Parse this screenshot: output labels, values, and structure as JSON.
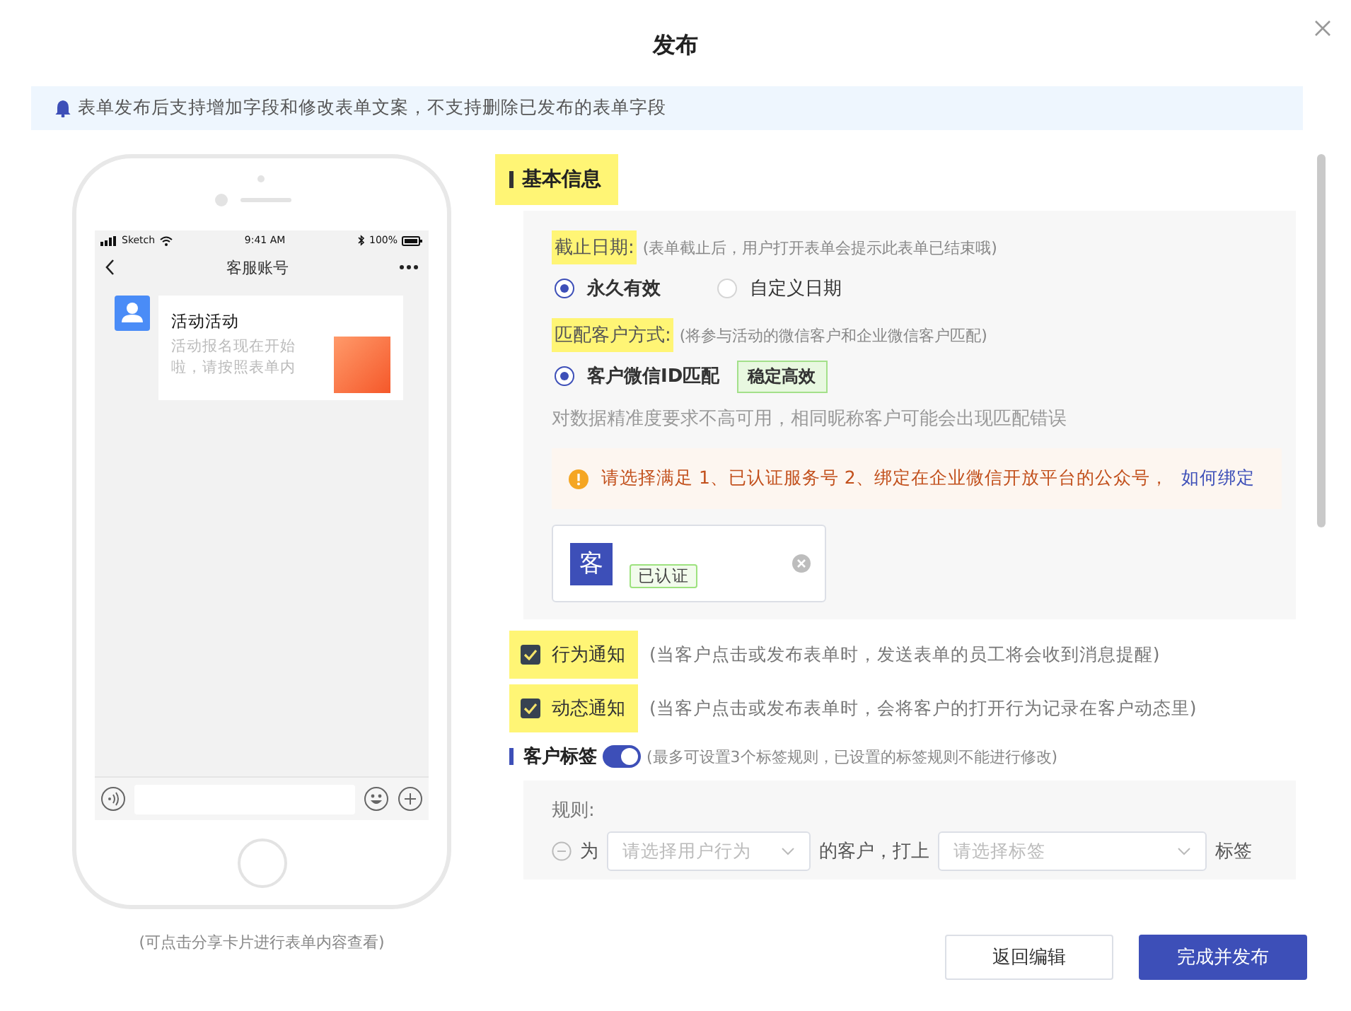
{
  "dialog": {
    "title": "发布"
  },
  "notice": {
    "text": "表单发布后支持增加字段和修改表单文案，不支持删除已发布的表单字段"
  },
  "phone": {
    "status": {
      "carrier": "Sketch",
      "time": "9:41 AM",
      "battery": "100%"
    },
    "nav_title": "客服账号",
    "message": {
      "title": "活动活动",
      "desc": "活动报名现在开始啦，请按照表单内"
    },
    "caption": "(可点击分享卡片进行表单内容查看)"
  },
  "form": {
    "section": {
      "title": "基本信息",
      "highlighted": true
    },
    "deadline": {
      "label": "截止日期:",
      "highlighted": true,
      "hint": "(表单截止后，用户打开表单会提示此表单已结束哦)",
      "options": [
        {
          "label": "永久有效",
          "selected": true
        },
        {
          "label": "自定义日期",
          "selected": false
        }
      ]
    },
    "match": {
      "label": "匹配客户方式:",
      "highlighted": true,
      "hint": "(将参与活动的微信客户和企业微信客户匹配)",
      "options": [
        {
          "label": "客户微信ID匹配",
          "selected": true,
          "tag": "稳定高效"
        }
      ],
      "note": "对数据精准度要求不高可用，相同昵称客户可能会出现匹配错误"
    },
    "warning": {
      "text": "请选择满足 1、已认证服务号 2、绑定在企业微信开放平台的公众号，",
      "link": "如何绑定"
    },
    "account": {
      "avatar": "客",
      "badge": "已认证"
    },
    "notifications": [
      {
        "label": "行为通知",
        "checked": true,
        "highlighted": true,
        "hint": "(当客户点击或发布表单时，发送表单的员工将会收到消息提醒)"
      },
      {
        "label": "动态通知",
        "checked": true,
        "highlighted": true,
        "hint": "(当客户点击或发布表单时，会将客户的打开行为记录在客户动态里)"
      }
    ],
    "tags": {
      "title": "客户标签",
      "on": true,
      "hint": "(最多可设置3个标签规则，已设置的标签规则不能进行修改)",
      "rule_label": "规则:",
      "rule": {
        "prefix": "为",
        "behavior_placeholder": "请选择用户行为",
        "middle": "的客户，打上",
        "tag_placeholder": "请选择标签",
        "suffix": "标签"
      }
    }
  },
  "buttons": [
    {
      "label": "返回编辑",
      "kind": "secondary"
    },
    {
      "label": "完成并发布",
      "kind": "primary"
    }
  ]
}
